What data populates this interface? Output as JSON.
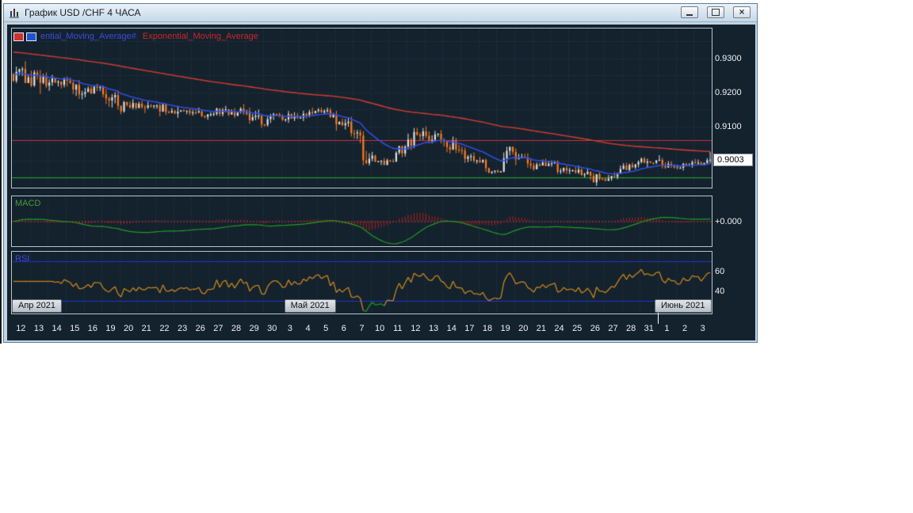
{
  "window": {
    "title": "График USD /CHF 4 ЧАСА",
    "controls": {
      "minimize_icon": "minimize-icon",
      "restore_icon": "restore-icon",
      "close_icon": "close-icon",
      "close_glyph": "×"
    }
  },
  "legend": {
    "blue_label": "ential_Moving_Average#",
    "red_label": "Exponential_Moving_Average"
  },
  "panels": {
    "macd_label": "MACD",
    "rsi_label": "RSI",
    "macd_zero_label": "+0.000"
  },
  "price_axis": {
    "ticks": [
      {
        "label": "0.9300",
        "value": 0.93
      },
      {
        "label": "0.9200",
        "value": 0.92
      },
      {
        "label": "0.9100",
        "value": 0.91
      }
    ],
    "current": {
      "label": "0.9003",
      "value": 0.9003
    }
  },
  "time_axis": {
    "day_labels": [
      "12",
      "13",
      "14",
      "15",
      "16",
      "19",
      "20",
      "21",
      "22",
      "23",
      "26",
      "27",
      "28",
      "29",
      "30",
      "3",
      "4",
      "5",
      "6",
      "7",
      "10",
      "11",
      "12",
      "13",
      "14",
      "17",
      "18",
      "19",
      "20",
      "21",
      "24",
      "25",
      "26",
      "27",
      "28",
      "31",
      "1",
      "2",
      "3"
    ],
    "month_badges": [
      {
        "label": "Апр 2021",
        "day_index": 0,
        "separator": false
      },
      {
        "label": "Май 2021",
        "day_index": 15,
        "separator": false
      },
      {
        "label": "Июнь 2021",
        "day_index": 36,
        "separator": true
      }
    ]
  },
  "chart_data": {
    "type": "candlestick",
    "symbol": "USD/CHF",
    "timeframe": "4 часа",
    "title": "График USD /CHF 4 ЧАСА",
    "grid": true,
    "ylim": [
      0.8921,
      0.9388
    ],
    "x_day_labels": [
      "Apr12",
      "Apr13",
      "Apr14",
      "Apr15",
      "Apr16",
      "Apr19",
      "Apr20",
      "Apr21",
      "Apr22",
      "Apr23",
      "Apr26",
      "Apr27",
      "Apr28",
      "Apr29",
      "Apr30",
      "May3",
      "May4",
      "May5",
      "May6",
      "May7",
      "May10",
      "May11",
      "May12",
      "May13",
      "May14",
      "May17",
      "May18",
      "May19",
      "May20",
      "May21",
      "May24",
      "May25",
      "May26",
      "May27",
      "May28",
      "May31",
      "Jun1",
      "Jun2",
      "Jun3"
    ],
    "daily_ohlc": [
      [
        0.9255,
        0.9292,
        0.9228,
        0.9245
      ],
      [
        0.9245,
        0.9266,
        0.9196,
        0.922
      ],
      [
        0.922,
        0.9252,
        0.9205,
        0.9242
      ],
      [
        0.9242,
        0.9247,
        0.918,
        0.9196
      ],
      [
        0.9196,
        0.9226,
        0.9186,
        0.9216
      ],
      [
        0.9216,
        0.9221,
        0.915,
        0.9161
      ],
      [
        0.9161,
        0.9181,
        0.9136,
        0.9155
      ],
      [
        0.9155,
        0.9176,
        0.914,
        0.9162
      ],
      [
        0.9162,
        0.9171,
        0.913,
        0.9146
      ],
      [
        0.9146,
        0.9161,
        0.9126,
        0.914
      ],
      [
        0.914,
        0.9156,
        0.912,
        0.9136
      ],
      [
        0.9136,
        0.9161,
        0.913,
        0.9151
      ],
      [
        0.9151,
        0.9166,
        0.9125,
        0.9141
      ],
      [
        0.9141,
        0.9156,
        0.9096,
        0.9106
      ],
      [
        0.9106,
        0.9141,
        0.91,
        0.9131
      ],
      [
        0.9131,
        0.9146,
        0.9111,
        0.9126
      ],
      [
        0.9126,
        0.9156,
        0.9116,
        0.9146
      ],
      [
        0.9146,
        0.9156,
        0.9126,
        0.9136
      ],
      [
        0.9136,
        0.9146,
        0.9071,
        0.9081
      ],
      [
        0.9081,
        0.9091,
        0.8986,
        0.9006
      ],
      [
        0.9006,
        0.9026,
        0.8986,
        0.9001
      ],
      [
        0.9001,
        0.9046,
        0.8996,
        0.9041
      ],
      [
        0.9041,
        0.9096,
        0.9031,
        0.9086
      ],
      [
        0.9086,
        0.9101,
        0.9051,
        0.9061
      ],
      [
        0.9061,
        0.9071,
        0.9021,
        0.9031
      ],
      [
        0.9031,
        0.9041,
        0.8991,
        0.9001
      ],
      [
        0.9001,
        0.9011,
        0.8961,
        0.8971
      ],
      [
        0.8971,
        0.9041,
        0.8966,
        0.9026
      ],
      [
        0.9026,
        0.9036,
        0.8976,
        0.8986
      ],
      [
        0.8986,
        0.9006,
        0.8971,
        0.8991
      ],
      [
        0.8991,
        0.9001,
        0.8961,
        0.8971
      ],
      [
        0.8971,
        0.8986,
        0.8951,
        0.8961
      ],
      [
        0.8961,
        0.8976,
        0.8926,
        0.8946
      ],
      [
        0.8946,
        0.8986,
        0.8941,
        0.8976
      ],
      [
        0.8976,
        0.9001,
        0.8966,
        0.8996
      ],
      [
        0.8996,
        0.9011,
        0.8981,
        0.9001
      ],
      [
        0.9001,
        0.9016,
        0.8976,
        0.8986
      ],
      [
        0.8986,
        0.9001,
        0.8971,
        0.8996
      ],
      [
        0.8996,
        0.9026,
        0.8986,
        0.9003
      ]
    ],
    "current_price": 0.9003,
    "overlays": {
      "ema_fast": {
        "name": "Exponential_Moving_Average",
        "color": "#2e4ede",
        "period": 20,
        "start": 0.9255
      },
      "ema_slow": {
        "name": "Exponential_Moving_Average",
        "color": "#c43a2e",
        "period": 140,
        "start": 0.932
      }
    },
    "hlines": [
      {
        "color": "#cc3434",
        "value": 0.906
      },
      {
        "color": "#2aa02a",
        "value": 0.8952
      }
    ],
    "indicators": {
      "macd": {
        "histogram_color": "#b01c1c",
        "signal_color": "#1f9e1f",
        "zero_color": "#cc3333",
        "zero_label": "+0.000"
      },
      "rsi": {
        "line_color": "#c8861e",
        "oversold_color": "#18a018",
        "level_color": "#2233cc",
        "levels": [
          70,
          30
        ],
        "tick_labels": [
          60,
          40
        ],
        "range": [
          17.5,
          80
        ]
      }
    }
  },
  "colors": {
    "background": "#14222e",
    "panel_border": "#b9c3cb",
    "grid": "#263a4e",
    "candle_up": "#e2e2e2",
    "candle_down": "#ff7a1e",
    "axis_text": "#eceff2"
  }
}
